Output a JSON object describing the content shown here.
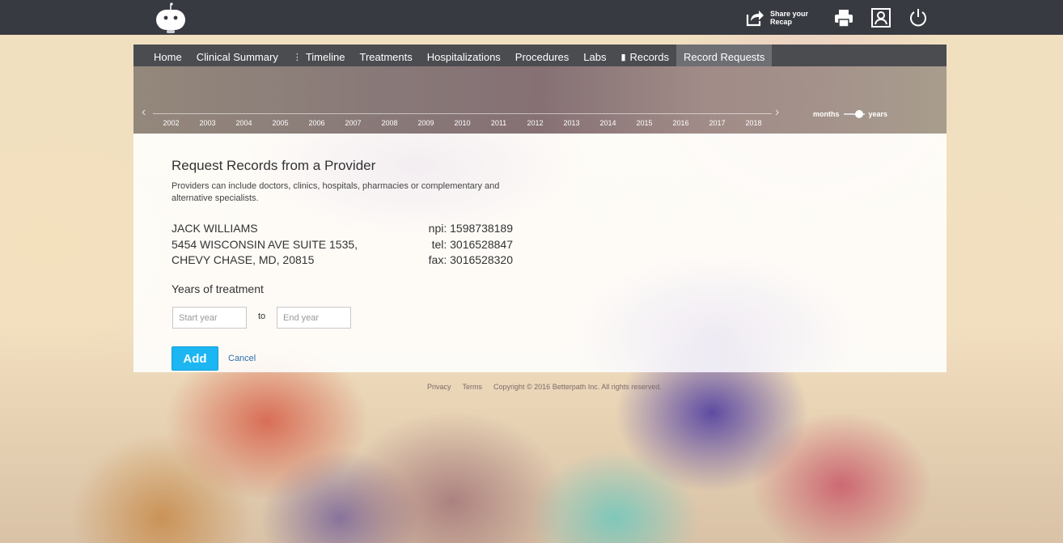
{
  "topbar": {
    "logo": "robot-logo",
    "share_label": "Share your Recap",
    "icons": [
      "share-icon",
      "print-icon",
      "profile-icon",
      "power-icon"
    ]
  },
  "nav": {
    "items": [
      {
        "label": "Home",
        "icon": null
      },
      {
        "label": "Clinical Summary",
        "icon": null
      },
      {
        "label": "Timeline",
        "icon": "vertical-dots-icon"
      },
      {
        "label": "Treatments",
        "icon": null
      },
      {
        "label": "Hospitalizations",
        "icon": null
      },
      {
        "label": "Procedures",
        "icon": null
      },
      {
        "label": "Labs",
        "icon": null
      },
      {
        "label": "Records",
        "icon": "document-icon"
      },
      {
        "label": "Record Requests",
        "icon": null
      }
    ],
    "active": "Record Requests"
  },
  "timeline": {
    "years": [
      "2002",
      "2003",
      "2004",
      "2005",
      "2006",
      "2007",
      "2008",
      "2009",
      "2010",
      "2011",
      "2012",
      "2013",
      "2014",
      "2015",
      "2016",
      "2017",
      "2018"
    ],
    "toggle": {
      "left": "months",
      "right": "years",
      "selected": "years"
    }
  },
  "request": {
    "title": "Request Records from a Provider",
    "description": "Providers can include doctors, clinics, hospitals, pharmacies or complementary and alternative specialists.",
    "provider": {
      "name": "JACK WILLIAMS",
      "address_line1": "5454 WISCONSIN AVE SUITE 1535,",
      "address_line2": "CHEVY CHASE, MD, 20815",
      "npi": "npi: 1598738189",
      "tel": "tel: 3016528847",
      "fax": "fax: 3016528320"
    },
    "years_label": "Years of treatment",
    "start_placeholder": "Start year",
    "end_placeholder": "End year",
    "to_label": "to",
    "add_label": "Add",
    "cancel_label": "Cancel"
  },
  "footer": {
    "privacy": "Privacy",
    "terms": "Terms",
    "copyright": "Copyright © 2016 Betterpath Inc. All rights reserved."
  },
  "colors": {
    "topbar": "#383a41",
    "nav": "#4b4c50",
    "nav_active": "#6e6f73",
    "add_button": "#1cb6f2",
    "cancel_link": "#2a6fb0"
  }
}
